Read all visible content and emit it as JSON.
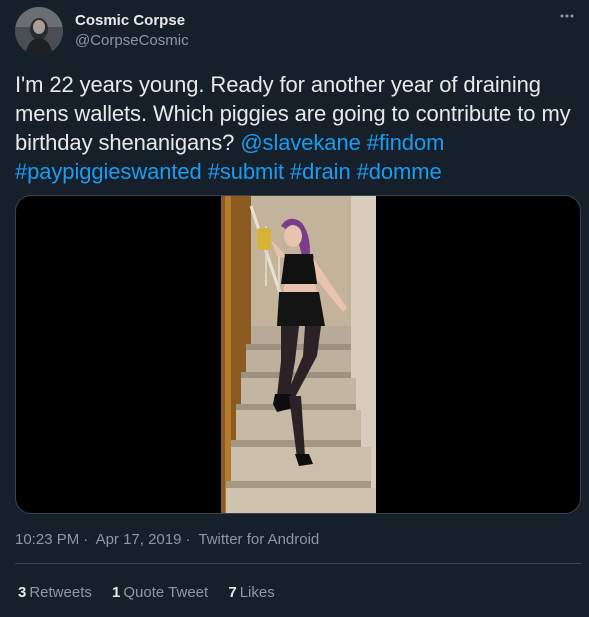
{
  "author": {
    "display_name": "Cosmic Corpse",
    "handle": "@CorpseCosmic"
  },
  "tweet": {
    "text_plain": "I'm 22 years young. Ready for another year of draining mens wallets. Which piggies are going to contribute to my birthday shenanigans?",
    "mention": "@slavekane",
    "hashtags": [
      "#findom",
      "#paypiggieswanted",
      "#submit",
      "#drain",
      "#domme"
    ]
  },
  "meta": {
    "time": "10:23 PM",
    "date": "Apr 17, 2019",
    "source": "Twitter for Android",
    "separator": "·"
  },
  "stats": {
    "retweets_count": "3",
    "retweets_label": "Retweets",
    "quotes_count": "1",
    "quotes_label": "Quote Tweet",
    "likes_count": "7",
    "likes_label": "Likes"
  },
  "icons": {
    "more": "more-options-icon"
  },
  "colors": {
    "background": "#15202b",
    "link": "#1d9bf0",
    "secondary_text": "#8b98a5",
    "divider": "#38444d"
  }
}
